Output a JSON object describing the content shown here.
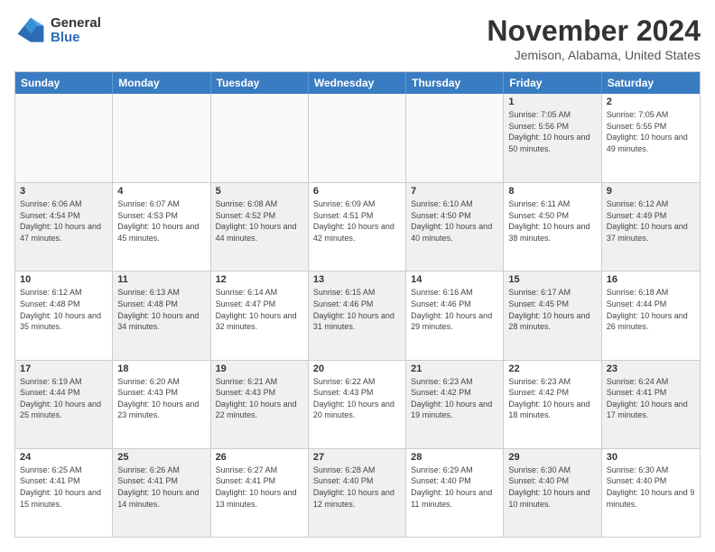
{
  "logo": {
    "general": "General",
    "blue": "Blue"
  },
  "title": "November 2024",
  "subtitle": "Jemison, Alabama, United States",
  "headers": [
    "Sunday",
    "Monday",
    "Tuesday",
    "Wednesday",
    "Thursday",
    "Friday",
    "Saturday"
  ],
  "rows": [
    [
      {
        "day": "",
        "info": "",
        "empty": true
      },
      {
        "day": "",
        "info": "",
        "empty": true
      },
      {
        "day": "",
        "info": "",
        "empty": true
      },
      {
        "day": "",
        "info": "",
        "empty": true
      },
      {
        "day": "",
        "info": "",
        "empty": true
      },
      {
        "day": "1",
        "info": "Sunrise: 7:05 AM\nSunset: 5:56 PM\nDaylight: 10 hours and 50 minutes.",
        "shaded": true
      },
      {
        "day": "2",
        "info": "Sunrise: 7:05 AM\nSunset: 5:55 PM\nDaylight: 10 hours and 49 minutes."
      }
    ],
    [
      {
        "day": "3",
        "info": "Sunrise: 6:06 AM\nSunset: 4:54 PM\nDaylight: 10 hours and 47 minutes.",
        "shaded": true
      },
      {
        "day": "4",
        "info": "Sunrise: 6:07 AM\nSunset: 4:53 PM\nDaylight: 10 hours and 45 minutes."
      },
      {
        "day": "5",
        "info": "Sunrise: 6:08 AM\nSunset: 4:52 PM\nDaylight: 10 hours and 44 minutes.",
        "shaded": true
      },
      {
        "day": "6",
        "info": "Sunrise: 6:09 AM\nSunset: 4:51 PM\nDaylight: 10 hours and 42 minutes."
      },
      {
        "day": "7",
        "info": "Sunrise: 6:10 AM\nSunset: 4:50 PM\nDaylight: 10 hours and 40 minutes.",
        "shaded": true
      },
      {
        "day": "8",
        "info": "Sunrise: 6:11 AM\nSunset: 4:50 PM\nDaylight: 10 hours and 38 minutes."
      },
      {
        "day": "9",
        "info": "Sunrise: 6:12 AM\nSunset: 4:49 PM\nDaylight: 10 hours and 37 minutes.",
        "shaded": true
      }
    ],
    [
      {
        "day": "10",
        "info": "Sunrise: 6:12 AM\nSunset: 4:48 PM\nDaylight: 10 hours and 35 minutes."
      },
      {
        "day": "11",
        "info": "Sunrise: 6:13 AM\nSunset: 4:48 PM\nDaylight: 10 hours and 34 minutes.",
        "shaded": true
      },
      {
        "day": "12",
        "info": "Sunrise: 6:14 AM\nSunset: 4:47 PM\nDaylight: 10 hours and 32 minutes."
      },
      {
        "day": "13",
        "info": "Sunrise: 6:15 AM\nSunset: 4:46 PM\nDaylight: 10 hours and 31 minutes.",
        "shaded": true
      },
      {
        "day": "14",
        "info": "Sunrise: 6:16 AM\nSunset: 4:46 PM\nDaylight: 10 hours and 29 minutes."
      },
      {
        "day": "15",
        "info": "Sunrise: 6:17 AM\nSunset: 4:45 PM\nDaylight: 10 hours and 28 minutes.",
        "shaded": true
      },
      {
        "day": "16",
        "info": "Sunrise: 6:18 AM\nSunset: 4:44 PM\nDaylight: 10 hours and 26 minutes."
      }
    ],
    [
      {
        "day": "17",
        "info": "Sunrise: 6:19 AM\nSunset: 4:44 PM\nDaylight: 10 hours and 25 minutes.",
        "shaded": true
      },
      {
        "day": "18",
        "info": "Sunrise: 6:20 AM\nSunset: 4:43 PM\nDaylight: 10 hours and 23 minutes."
      },
      {
        "day": "19",
        "info": "Sunrise: 6:21 AM\nSunset: 4:43 PM\nDaylight: 10 hours and 22 minutes.",
        "shaded": true
      },
      {
        "day": "20",
        "info": "Sunrise: 6:22 AM\nSunset: 4:43 PM\nDaylight: 10 hours and 20 minutes."
      },
      {
        "day": "21",
        "info": "Sunrise: 6:23 AM\nSunset: 4:42 PM\nDaylight: 10 hours and 19 minutes.",
        "shaded": true
      },
      {
        "day": "22",
        "info": "Sunrise: 6:23 AM\nSunset: 4:42 PM\nDaylight: 10 hours and 18 minutes."
      },
      {
        "day": "23",
        "info": "Sunrise: 6:24 AM\nSunset: 4:41 PM\nDaylight: 10 hours and 17 minutes.",
        "shaded": true
      }
    ],
    [
      {
        "day": "24",
        "info": "Sunrise: 6:25 AM\nSunset: 4:41 PM\nDaylight: 10 hours and 15 minutes."
      },
      {
        "day": "25",
        "info": "Sunrise: 6:26 AM\nSunset: 4:41 PM\nDaylight: 10 hours and 14 minutes.",
        "shaded": true
      },
      {
        "day": "26",
        "info": "Sunrise: 6:27 AM\nSunset: 4:41 PM\nDaylight: 10 hours and 13 minutes."
      },
      {
        "day": "27",
        "info": "Sunrise: 6:28 AM\nSunset: 4:40 PM\nDaylight: 10 hours and 12 minutes.",
        "shaded": true
      },
      {
        "day": "28",
        "info": "Sunrise: 6:29 AM\nSunset: 4:40 PM\nDaylight: 10 hours and 11 minutes."
      },
      {
        "day": "29",
        "info": "Sunrise: 6:30 AM\nSunset: 4:40 PM\nDaylight: 10 hours and 10 minutes.",
        "shaded": true
      },
      {
        "day": "30",
        "info": "Sunrise: 6:30 AM\nSunset: 4:40 PM\nDaylight: 10 hours and 9 minutes."
      }
    ]
  ]
}
